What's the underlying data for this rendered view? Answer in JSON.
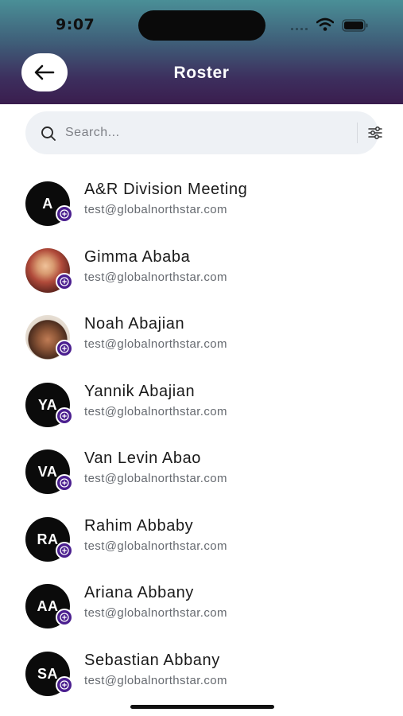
{
  "status_bar": {
    "time": "9:07"
  },
  "header": {
    "title": "Roster",
    "back_icon": "arrow-left-icon"
  },
  "search": {
    "placeholder": "Search...",
    "value": "",
    "filter_icon": "sliders-icon"
  },
  "colors": {
    "badge": "#4b1f8f",
    "avatar_bg": "#0b0b0b"
  },
  "contacts": [
    {
      "name": "A&R Division Meeting",
      "email": "test@globalnorthstar.com",
      "initials": "A"
    },
    {
      "name": "Gimma Ababa",
      "email": "test@globalnorthstar.com",
      "initials": "",
      "avatar": "photo"
    },
    {
      "name": "Noah Abajian",
      "email": "test@globalnorthstar.com",
      "initials": "",
      "avatar": "photo"
    },
    {
      "name": "Yannik Abajian",
      "email": "test@globalnorthstar.com",
      "initials": "YA"
    },
    {
      "name": "Van Levin Abao",
      "email": "test@globalnorthstar.com",
      "initials": "VA"
    },
    {
      "name": "Rahim Abbaby",
      "email": "test@globalnorthstar.com",
      "initials": "RA"
    },
    {
      "name": "Ariana Abbany",
      "email": "test@globalnorthstar.com",
      "initials": "AA"
    },
    {
      "name": "Sebastian Abbany",
      "email": "test@globalnorthstar.com",
      "initials": "SA"
    }
  ]
}
